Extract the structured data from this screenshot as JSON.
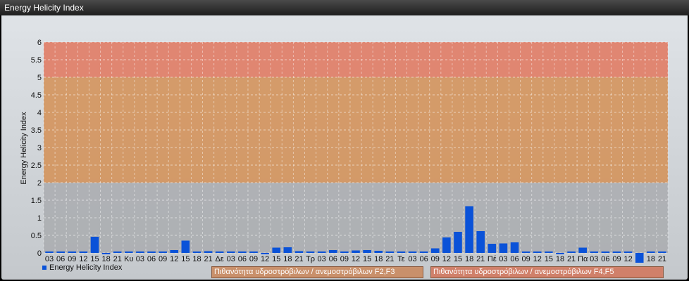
{
  "window": {
    "title": "Energy Helicity Index"
  },
  "legend": {
    "series_label": "Energy Helicity Index",
    "zones": [
      "Πιθανότητα υδροστρόβιλων / ανεμοστρόβιλων F2,F3",
      "Πιθανότητα υδροστρόβιλων / ανεμοστρόβιλων F4,F5"
    ]
  },
  "colors": {
    "bar": "#0a52d8",
    "zone_low": "#a9acaf",
    "zone_mid": "#d48f55",
    "zone_high": "#e07c65",
    "zone_legend_1": "#c9906b",
    "zone_legend_2": "#d0806a"
  },
  "chart_data": {
    "type": "bar",
    "ylabel": "Energy Helicity Index",
    "ylim": [
      0,
      6
    ],
    "yticks": [
      "0",
      "0.5",
      "1",
      "1.5",
      "2",
      "2.5",
      "3",
      "3.5",
      "4",
      "4.5",
      "5",
      "5.5",
      "6"
    ],
    "bands": [
      {
        "from": 2,
        "to": 5
      },
      {
        "from": 5,
        "to": 6
      }
    ],
    "grid": true,
    "categories": [
      "03",
      "06",
      "09",
      "12",
      "15",
      "18",
      "21",
      "Κυ",
      "03",
      "06",
      "09",
      "12",
      "15",
      "18",
      "21",
      "Δε",
      "03",
      "06",
      "09",
      "12",
      "15",
      "18",
      "21",
      "Τρ",
      "03",
      "06",
      "09",
      "12",
      "15",
      "18",
      "21",
      "Τε",
      "03",
      "06",
      "09",
      "12",
      "15",
      "18",
      "21",
      "Πέ",
      "03",
      "06",
      "09",
      "12",
      "15",
      "18",
      "21",
      "Πα",
      "03",
      "06",
      "09",
      "12",
      "15",
      "18",
      "21"
    ],
    "x_labels_visible": [
      "03",
      "06",
      "09",
      "12",
      "15",
      "18",
      "21",
      "Κυ",
      "03",
      "06",
      "09",
      "12",
      "15",
      "18",
      "21",
      "Δε",
      "03",
      "06",
      "09",
      "12",
      "15",
      "18",
      "21",
      "Τρ",
      "03",
      "06",
      "09",
      "12",
      "15",
      "18",
      "21",
      "Τε",
      "03",
      "06",
      "09",
      "12",
      "15",
      "18",
      "21",
      "Πέ",
      "03",
      "06",
      "09",
      "12",
      "15",
      "18",
      "21",
      "Πα",
      "03",
      "06",
      "09",
      "12",
      "",
      "18",
      "21"
    ],
    "values": [
      0.01,
      0.01,
      0.01,
      0.01,
      0.46,
      -0.04,
      0.01,
      0.01,
      0.01,
      0.02,
      0.01,
      0.08,
      0.35,
      0.0,
      0.05,
      0.01,
      0.01,
      0.02,
      0.01,
      -0.04,
      0.15,
      0.16,
      0.05,
      0.02,
      0.03,
      0.08,
      0.04,
      0.07,
      0.08,
      0.06,
      0.02,
      0.01,
      0.01,
      0.01,
      0.13,
      0.44,
      0.6,
      1.33,
      0.62,
      0.26,
      0.27,
      0.3,
      0.03,
      0.04,
      0.02,
      -0.03,
      0.02,
      0.15,
      0.03,
      0.02,
      0.04,
      0.02,
      -0.28,
      0.02,
      0.02
    ]
  }
}
